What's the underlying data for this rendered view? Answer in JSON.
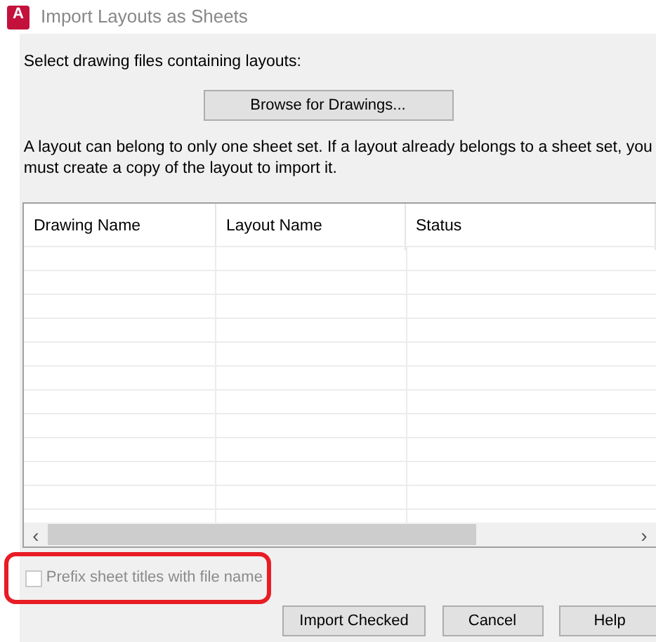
{
  "window": {
    "title": "Import Layouts as Sheets",
    "app_icon_letter": "A"
  },
  "prompt": "Select drawing files containing layouts:",
  "browse_button": "Browse for Drawings...",
  "note": "A layout can belong to only one sheet set. If a layout already belongs to a sheet set, you must create a copy of the layout to import it.",
  "table": {
    "columns": [
      "Drawing Name",
      "Layout Name",
      "Status"
    ],
    "scrollbar": {
      "left_arrow": "‹",
      "right_arrow": "›"
    }
  },
  "prefix_option": {
    "label": "Prefix sheet titles with file name",
    "checked": false,
    "disabled": true,
    "highlighted": true
  },
  "buttons": [
    "Import Checked",
    "Cancel",
    "Help"
  ]
}
